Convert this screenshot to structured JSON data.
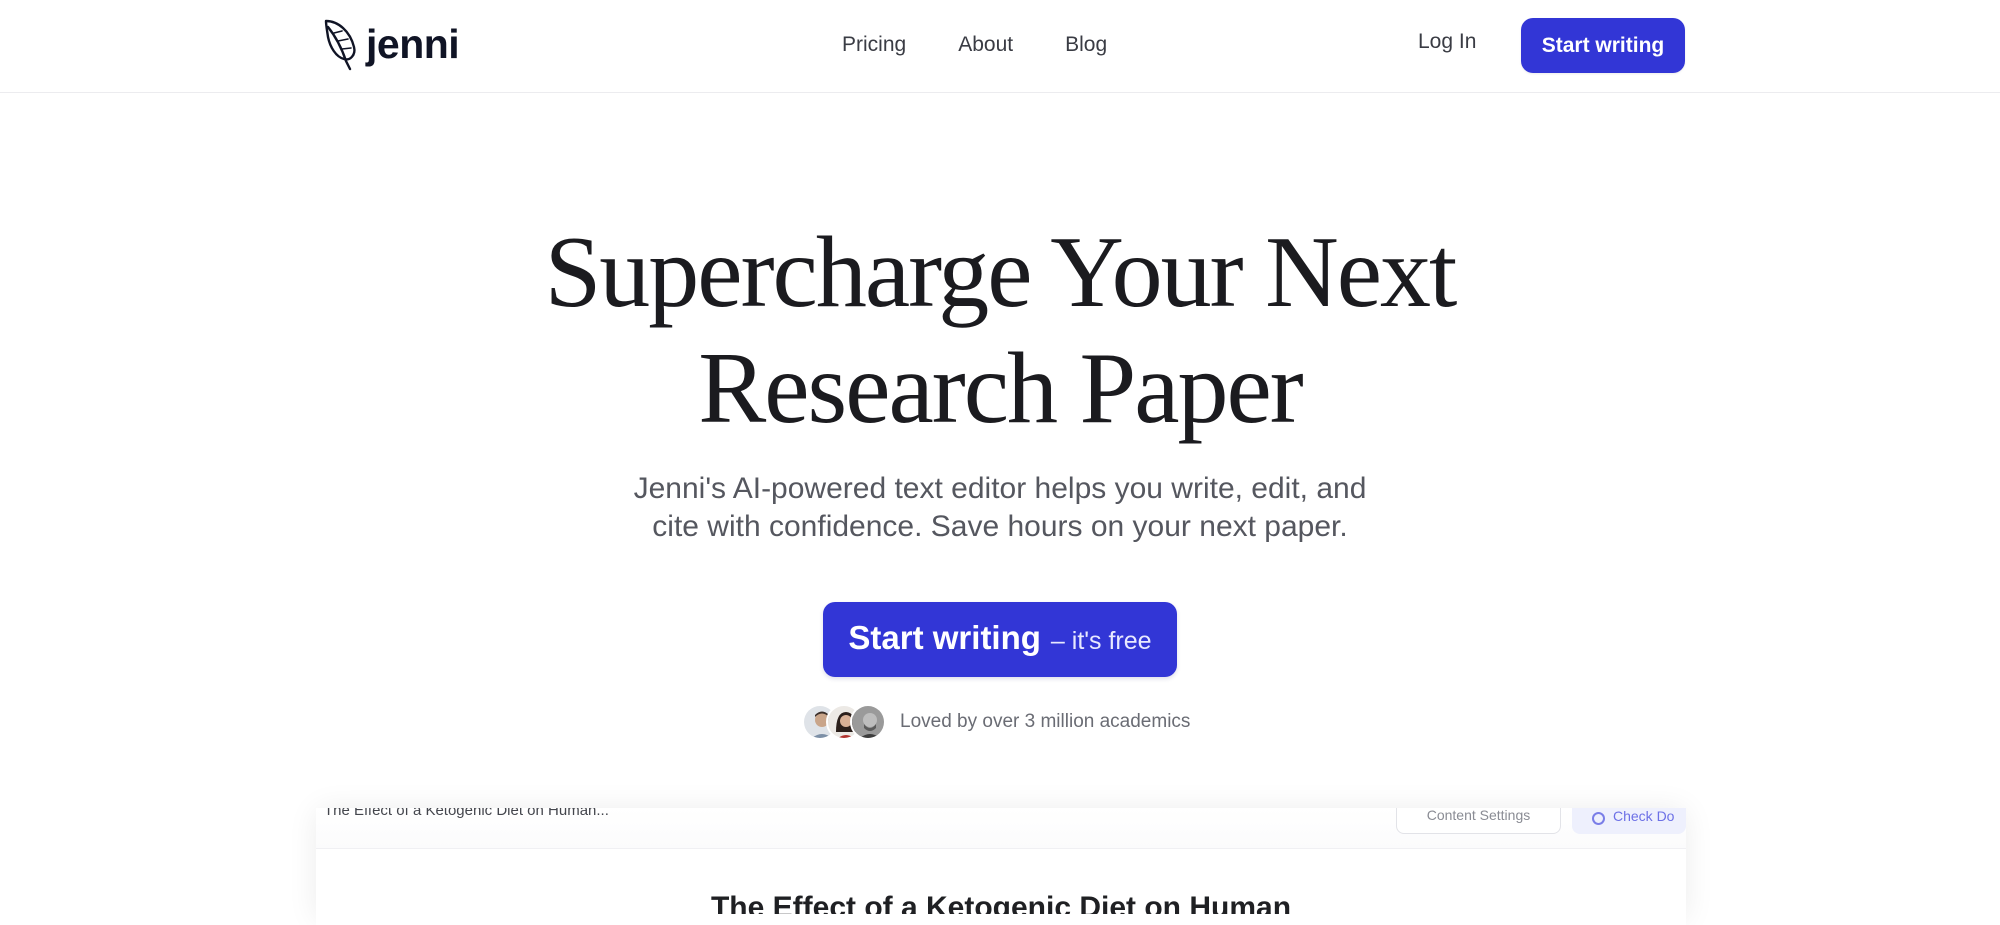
{
  "brand": {
    "name": "jenni",
    "accent": "#3236d6"
  },
  "nav": {
    "items": [
      {
        "label": "Pricing"
      },
      {
        "label": "About"
      },
      {
        "label": "Blog"
      }
    ],
    "login_label": "Log In",
    "cta_label": "Start writing"
  },
  "hero": {
    "title_line1": "Supercharge Your Next",
    "title_line2": "Research Paper",
    "subtitle_line1": "Jenni's AI-powered text editor helps you write, edit, and",
    "subtitle_line2": "cite with confidence. Save hours on your next paper.",
    "cta_main": "Start writing",
    "cta_sub": "– it's free",
    "social_proof": "Loved by over 3 million academics"
  },
  "preview": {
    "doc_name": "The Effect of a Ketogenic Diet on Human...",
    "settings_label": "Content Settings",
    "check_label": "Check Do",
    "doc_title": "The Effect of a Ketogenic Diet on Human"
  }
}
